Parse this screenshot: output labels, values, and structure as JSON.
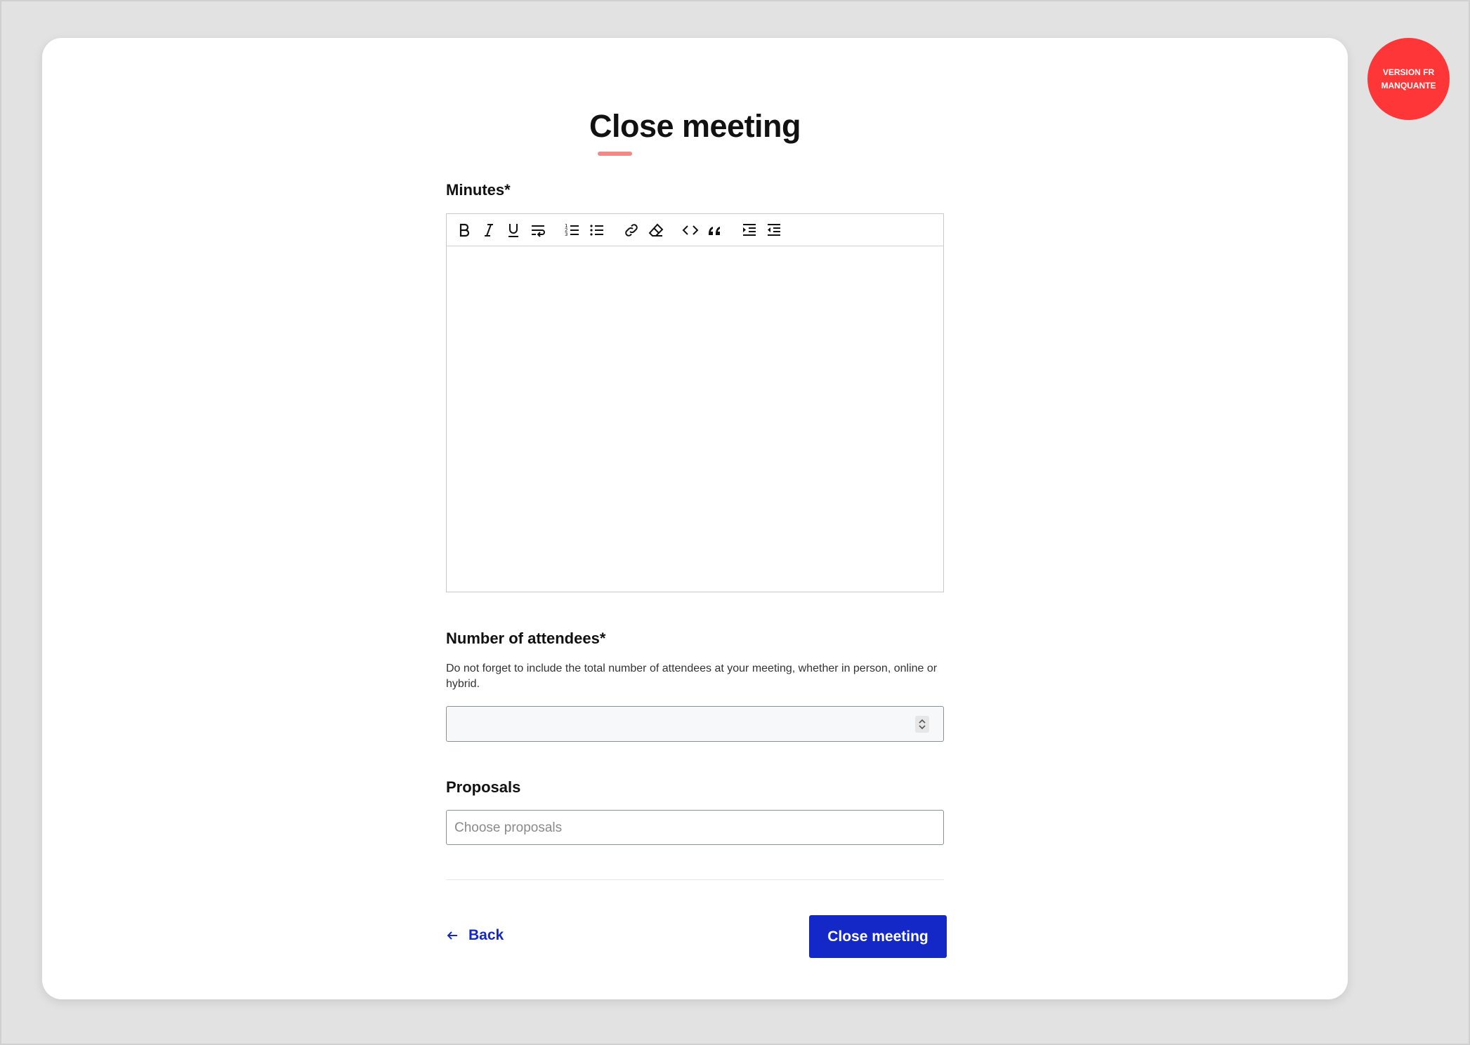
{
  "page": {
    "title": "Close meeting"
  },
  "form": {
    "minutes_label": "Minutes*",
    "toolbar": [
      {
        "name": "bold-icon",
        "glyph": "B"
      },
      {
        "name": "italic-icon",
        "glyph": "I"
      },
      {
        "name": "underline-icon",
        "glyph": "U"
      },
      {
        "name": "hard-break-icon",
        "glyph": "wrap"
      },
      {
        "name": "ordered-list-icon",
        "glyph": "ol"
      },
      {
        "name": "bullet-list-icon",
        "glyph": "ul"
      },
      {
        "name": "link-icon",
        "glyph": "link"
      },
      {
        "name": "eraser-icon",
        "glyph": "eraser"
      },
      {
        "name": "code-icon",
        "glyph": "code"
      },
      {
        "name": "quote-icon",
        "glyph": "quote"
      },
      {
        "name": "indent-icon",
        "glyph": "indent"
      },
      {
        "name": "outdent-icon",
        "glyph": "outdent"
      }
    ],
    "minutes_value": "",
    "attendees_label": "Number of attendees*",
    "attendees_help": "Do not forget to include the total number of attendees at your meeting, whether in person, online or hybrid.",
    "attendees_value": "",
    "proposals_label": "Proposals",
    "proposals_placeholder": "Choose proposals"
  },
  "actions": {
    "back_label": "Back",
    "submit_label": "Close meeting"
  },
  "badge": {
    "text": "VERSION FR MANQUANTE",
    "color": "#fe3637"
  },
  "colors": {
    "primary": "#1428c8",
    "accent_underline": "#f08a86"
  }
}
